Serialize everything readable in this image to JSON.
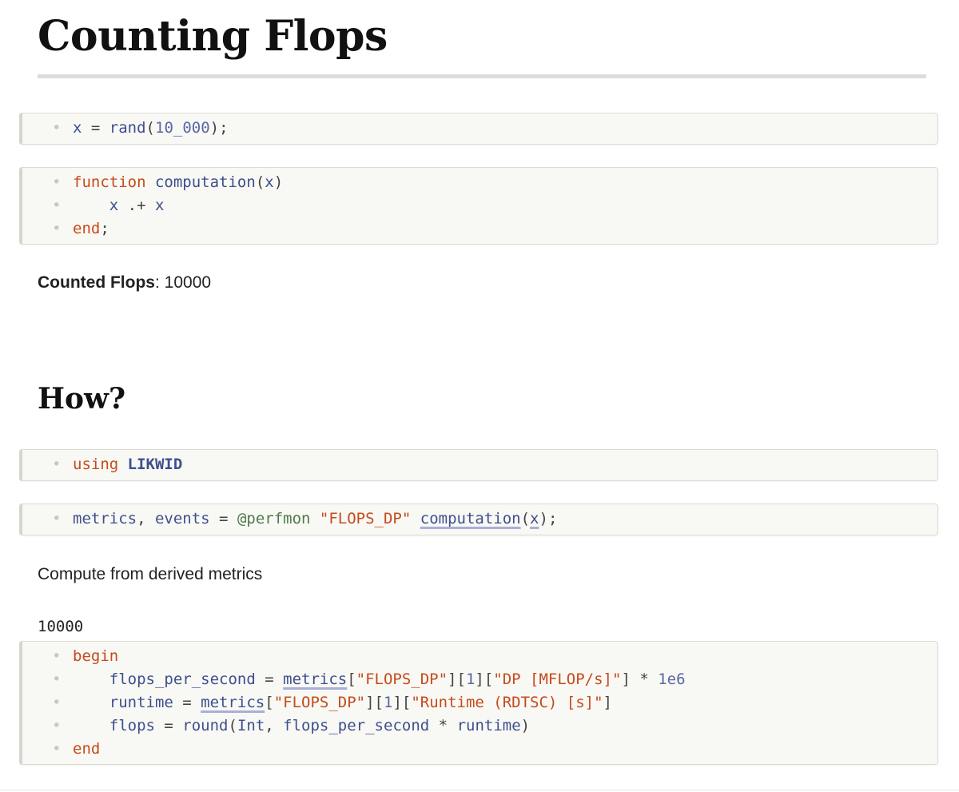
{
  "title": "Counting Flops",
  "section_heading": "How?",
  "cell_rand": {
    "t1": "x",
    "t2": " = ",
    "t3": "rand",
    "t4": "(",
    "t5": "10_000",
    "t6": ");"
  },
  "cell_function": {
    "l1_kw": "function",
    "l1_name": "computation",
    "l1_open": "(",
    "l1_arg": "x",
    "l1_close": ")",
    "l2_a": "x",
    "l2_op": " .+ ",
    "l2_b": "x",
    "l3_kw": "end",
    "l3_semi": ";"
  },
  "counted_flops": {
    "label": "Counted Flops",
    "separator": ": ",
    "value": "10000"
  },
  "cell_using": {
    "kw": "using",
    "module": "LIKWID"
  },
  "cell_perfmon": {
    "t1": "metrics",
    "t2": ", ",
    "t3": "events",
    "t4": " = ",
    "t5": "@perfmon",
    "t6": " ",
    "t7": "\"FLOPS_DP\"",
    "t8": " ",
    "t9": "computation",
    "t10": "(",
    "t11": "x",
    "t12": ");"
  },
  "derived_text": "Compute from derived metrics",
  "derived_output": "10000",
  "cell_derived": {
    "l1_kw": "begin",
    "l2_a": "flops_per_second",
    "l2_b": " = ",
    "l2_c": "metrics",
    "l2_d": "[",
    "l2_e": "\"FLOPS_DP\"",
    "l2_f": "][",
    "l2_g": "1",
    "l2_h": "][",
    "l2_i": "\"DP [MFLOP/s]\"",
    "l2_j": "] ",
    "l2_k": "*",
    "l2_l": " ",
    "l2_m": "1e6",
    "l3_a": "runtime",
    "l3_b": " = ",
    "l3_c": "metrics",
    "l3_d": "[",
    "l3_e": "\"FLOPS_DP\"",
    "l3_f": "][",
    "l3_g": "1",
    "l3_h": "][",
    "l3_i": "\"Runtime (RDTSC) [s]\"",
    "l3_j": "]",
    "l4_a": "flops",
    "l4_b": " = ",
    "l4_c": "round",
    "l4_d": "(",
    "l4_e": "Int",
    "l4_f": ", ",
    "l4_g": "flops_per_second",
    "l4_h": " ",
    "l4_i": "*",
    "l4_j": " ",
    "l4_k": "runtime",
    "l4_l": ")",
    "l5_kw": "end"
  },
  "gutter_marker": "•",
  "colors": {
    "keyword": "#c74a1b",
    "identifier": "#3e4f8f",
    "number": "#5a67a6",
    "macro": "#4e7a4a",
    "cell_background": "#f8f8f4"
  }
}
